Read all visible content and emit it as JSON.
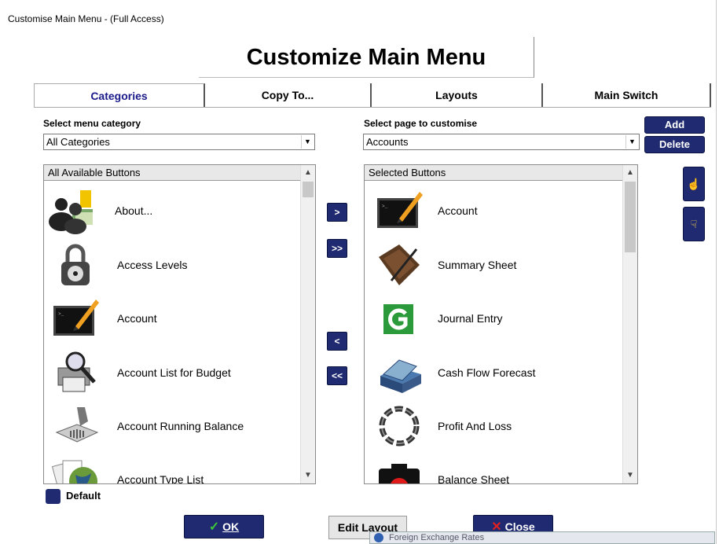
{
  "window": {
    "title": "Customise Main Menu - (Full Access)"
  },
  "header": {
    "title": "Customize Main Menu"
  },
  "tabs": [
    {
      "label": "Categories",
      "active": true
    },
    {
      "label": "Copy To..."
    },
    {
      "label": "Layouts"
    },
    {
      "label": "Main Switch"
    }
  ],
  "left": {
    "label": "Select menu category",
    "select_value": "All Categories",
    "list_header": "All Available Buttons",
    "items": [
      {
        "label": "About...",
        "icon": "users-icon"
      },
      {
        "label": "Access Levels",
        "icon": "padlock-icon"
      },
      {
        "label": "Account",
        "icon": "monitor-pencil-icon"
      },
      {
        "label": "Account List for Budget",
        "icon": "printer-magnifier-icon"
      },
      {
        "label": "Account Running Balance",
        "icon": "barcode-scanner-icon"
      },
      {
        "label": "Account Type List",
        "icon": "globe-papers-icon"
      }
    ]
  },
  "right": {
    "label": "Select page to customise",
    "select_value": "Accounts",
    "list_header": "Selected Buttons",
    "items": [
      {
        "label": "Account",
        "icon": "monitor-pencil-icon"
      },
      {
        "label": "Summary Sheet",
        "icon": "book-pen-icon"
      },
      {
        "label": "Journal Entry",
        "icon": "green-g-icon"
      },
      {
        "label": "Cash Flow Forecast",
        "icon": "cash-box-icon"
      },
      {
        "label": "Profit And Loss",
        "icon": "chain-icon"
      },
      {
        "label": "Balance Sheet",
        "icon": "record-button-icon"
      }
    ]
  },
  "buttons": {
    "move_right": ">",
    "move_all_right": ">>",
    "move_left": "<",
    "move_all_left": "<<",
    "add": "Add",
    "delete": "Delete",
    "ok": "OK",
    "edit_layout": "Edit Layout",
    "close": "Close"
  },
  "default_checkbox": {
    "label": "Default"
  },
  "background_window": {
    "title": "Foreign Exchange Rates"
  },
  "colors": {
    "accent": "#1f2a70",
    "tab_active_text": "#1a1a8a",
    "ok_check": "#3cc43c",
    "close_x": "#e02020"
  }
}
